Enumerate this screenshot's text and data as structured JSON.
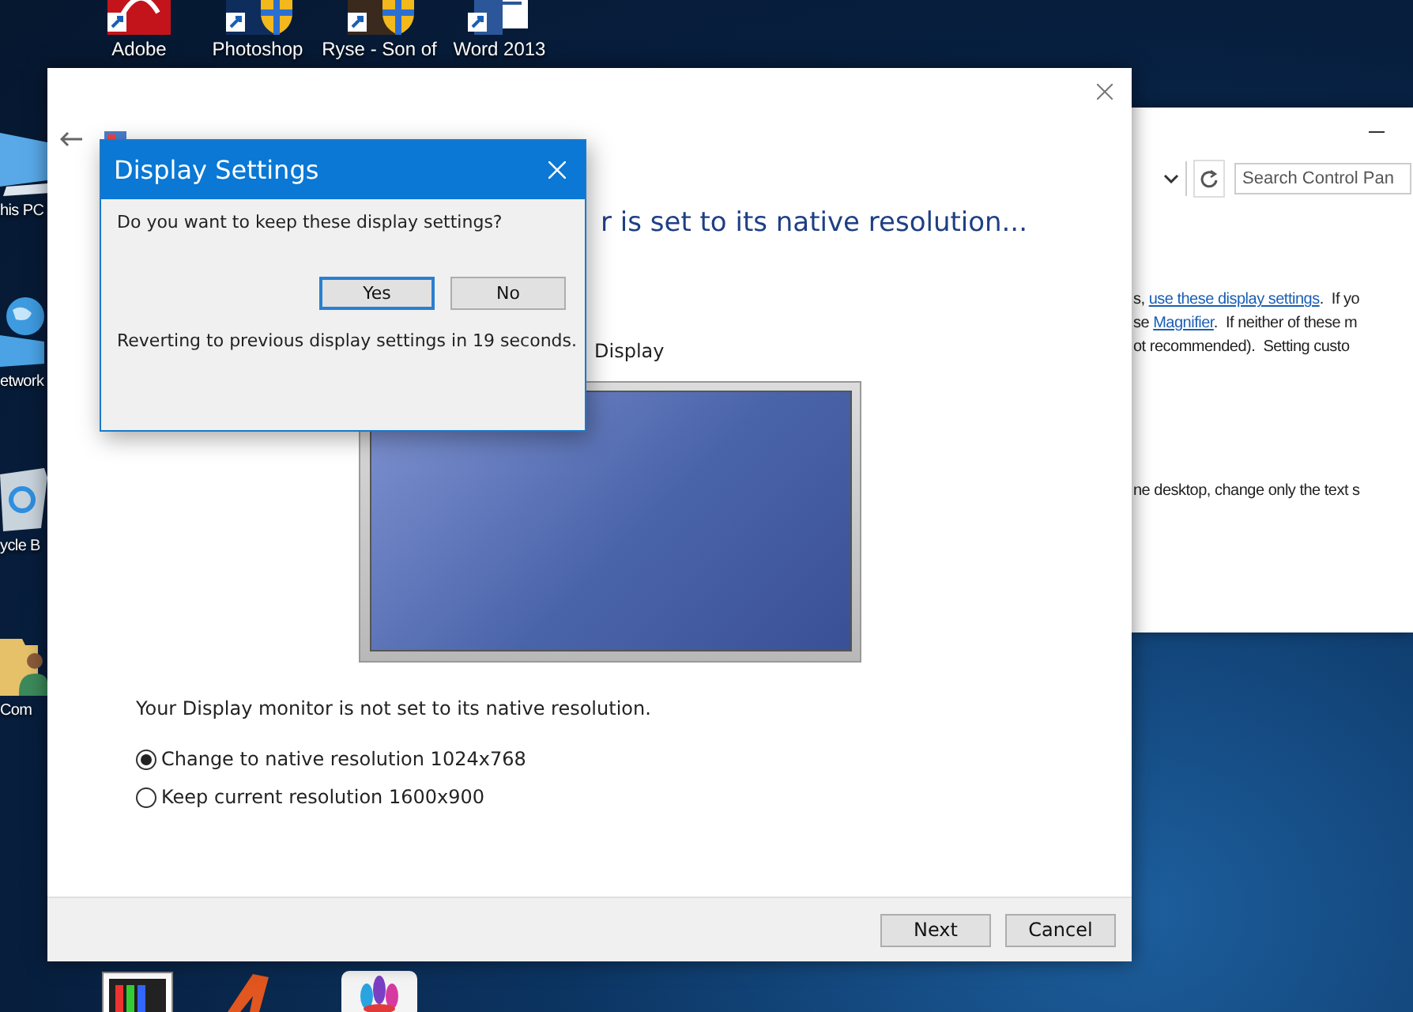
{
  "desktop": {
    "top_icons": [
      {
        "kind": "pdf",
        "label": "Adobe"
      },
      {
        "kind": "photoshop",
        "label": "Photoshop"
      },
      {
        "kind": "game",
        "label": "Ryse - Son of"
      },
      {
        "kind": "word",
        "label": "Word 2013"
      }
    ],
    "left_icons": [
      {
        "kind": "pc",
        "label": "his PC"
      },
      {
        "kind": "network",
        "label": "etwork"
      },
      {
        "kind": "bin",
        "label": "ycle B"
      },
      {
        "kind": "user",
        "label": "Com"
      }
    ],
    "bottom_icons": [
      {
        "kind": "tool"
      },
      {
        "kind": "logo"
      },
      {
        "kind": "flower"
      }
    ]
  },
  "control_panel": {
    "search": {
      "placeholder": "Search Control Pan"
    },
    "lines": [
      {
        "before": "s, ",
        "link": "use these display settings",
        "after": ".  If yo"
      },
      {
        "before": "se ",
        "link": "Magnifier",
        "after": ".  If neither of these m"
      },
      {
        "before": "ot recommended).  Setting custo"
      },
      {
        "before": "ne desktop, change only the text s"
      }
    ]
  },
  "wizard": {
    "heading": "r is set to its native resolution...",
    "display_label": "Display",
    "message": "Your Display monitor is not set to its native resolution.",
    "options": [
      {
        "label": "Change to native resolution 1024x768",
        "selected": true
      },
      {
        "label": "Keep current resolution 1600x900",
        "selected": false
      }
    ],
    "buttons": [
      {
        "label": "Next"
      },
      {
        "label": "Cancel"
      }
    ]
  },
  "dialog": {
    "title": "Display Settings",
    "question": "Do you want to keep these display settings?",
    "buttons": [
      {
        "label": "Yes",
        "selected": true
      },
      {
        "label": "No",
        "selected": false
      }
    ],
    "countdown": "Reverting to previous display settings in 19 seconds."
  }
}
